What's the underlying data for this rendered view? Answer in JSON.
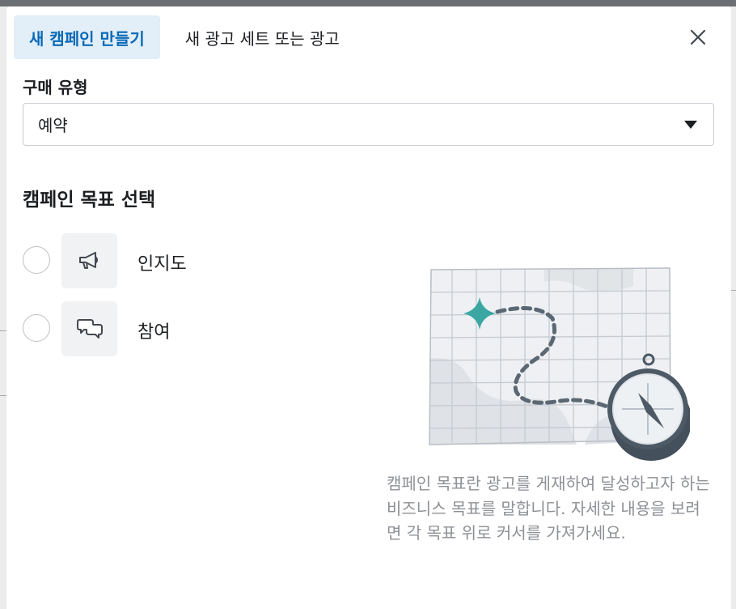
{
  "modal": {
    "tabs": [
      {
        "label": "새 캠페인 만들기",
        "active": true
      },
      {
        "label": "새 광고 세트 또는 광고",
        "active": false
      }
    ],
    "close_icon": "close-icon"
  },
  "purchase_type": {
    "label": "구매 유형",
    "selected": "예약",
    "caret_icon": "caret-down-icon"
  },
  "objective": {
    "title": "캠페인 목표 선택",
    "options": [
      {
        "label": "인지도",
        "icon": "megaphone-icon",
        "selected": false
      },
      {
        "label": "참여",
        "icon": "speech-bubbles-icon",
        "selected": false
      }
    ],
    "illustration": "map-with-compass-illustration",
    "description": "캠페인 목표란 광고를 게재하여 달성하고자 하는 비즈니스 목표를 말합니다. 자세한 내용을 보려면 각 목표 위로 커서를 가져가세요."
  },
  "colors": {
    "active_tab_bg": "#e2eef8",
    "active_tab_text": "#0a6ab7",
    "icon_box_bg": "#f1f2f4",
    "description_text": "#8d9095",
    "illustration_accent": "#3aa7a3",
    "illustration_dark": "#4d5a66"
  }
}
